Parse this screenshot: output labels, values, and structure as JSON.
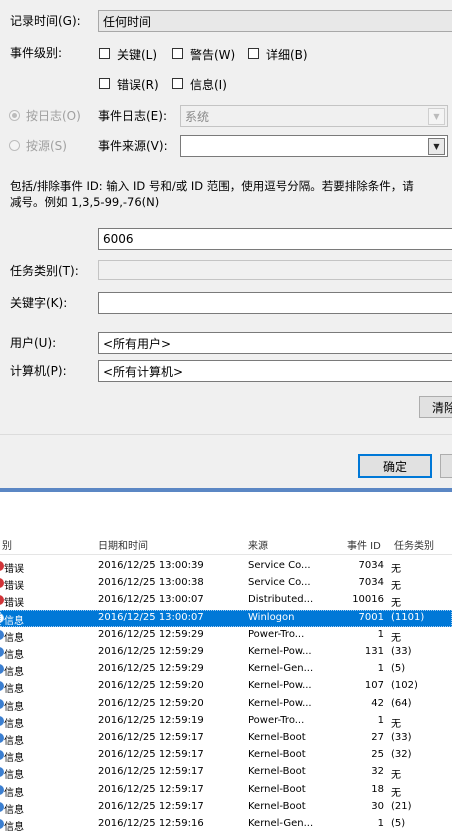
{
  "filter": {
    "logged_label": "记录时间(G):",
    "logged_value": "任何时间",
    "level_label": "事件级别:",
    "levels": [
      {
        "label": "关键(L)",
        "checked": false
      },
      {
        "label": "警告(W)",
        "checked": false
      },
      {
        "label": "详细(B)",
        "checked": false
      },
      {
        "label": "错误(R)",
        "checked": false
      },
      {
        "label": "信息(I)",
        "checked": false
      }
    ],
    "by_log_label": "按日志(O)",
    "by_source_label": "按源(S)",
    "event_logs_label": "事件日志(E):",
    "event_logs_value": "系统",
    "event_sources_label": "事件来源(V):",
    "event_sources_value": "",
    "description": "包括/排除事件 ID: 输入 ID 号和/或 ID 范围，使用逗号分隔。若要排除条件，请",
    "description_line2": "减号。例如 1,3,5-99,-76(N)",
    "event_id_value": "6006",
    "task_category_label": "任务类别(T):",
    "keywords_label": "关键字(K):",
    "user_label": "用户(U):",
    "user_value": "<所有用户>",
    "computer_label": "计算机(P):",
    "computer_value": "<所有计算机>",
    "clear_label": "清除",
    "ok_label": "确定"
  },
  "events": {
    "columns": [
      "别",
      "日期和时间",
      "来源",
      "事件 ID",
      "任务类别"
    ],
    "rows": [
      {
        "level": "错误",
        "type": "err",
        "date": "2016/12/25 13:00:39",
        "source": "Service Co...",
        "id": "7034",
        "task": "无",
        "selected": false
      },
      {
        "level": "错误",
        "type": "err",
        "date": "2016/12/25 13:00:38",
        "source": "Service Co...",
        "id": "7034",
        "task": "无",
        "selected": false
      },
      {
        "level": "错误",
        "type": "err",
        "date": "2016/12/25 13:00:07",
        "source": "Distributed...",
        "id": "10016",
        "task": "无",
        "selected": false
      },
      {
        "level": "信息",
        "type": "info",
        "date": "2016/12/25 13:00:07",
        "source": "Winlogon",
        "id": "7001",
        "task": "(1101)",
        "selected": true
      },
      {
        "level": "信息",
        "type": "info",
        "date": "2016/12/25 12:59:29",
        "source": "Power-Tro...",
        "id": "1",
        "task": "无",
        "selected": false
      },
      {
        "level": "信息",
        "type": "info",
        "date": "2016/12/25 12:59:29",
        "source": "Kernel-Pow...",
        "id": "131",
        "task": "(33)",
        "selected": false
      },
      {
        "level": "信息",
        "type": "info",
        "date": "2016/12/25 12:59:29",
        "source": "Kernel-Gen...",
        "id": "1",
        "task": "(5)",
        "selected": false
      },
      {
        "level": "信息",
        "type": "info",
        "date": "2016/12/25 12:59:20",
        "source": "Kernel-Pow...",
        "id": "107",
        "task": "(102)",
        "selected": false
      },
      {
        "level": "信息",
        "type": "info",
        "date": "2016/12/25 12:59:20",
        "source": "Kernel-Pow...",
        "id": "42",
        "task": "(64)",
        "selected": false
      },
      {
        "level": "信息",
        "type": "info",
        "date": "2016/12/25 12:59:19",
        "source": "Power-Tro...",
        "id": "1",
        "task": "无",
        "selected": false
      },
      {
        "level": "信息",
        "type": "info",
        "date": "2016/12/25 12:59:17",
        "source": "Kernel-Boot",
        "id": "27",
        "task": "(33)",
        "selected": false
      },
      {
        "level": "信息",
        "type": "info",
        "date": "2016/12/25 12:59:17",
        "source": "Kernel-Boot",
        "id": "25",
        "task": "(32)",
        "selected": false
      },
      {
        "level": "信息",
        "type": "info",
        "date": "2016/12/25 12:59:17",
        "source": "Kernel-Boot",
        "id": "32",
        "task": "无",
        "selected": false
      },
      {
        "level": "信息",
        "type": "info",
        "date": "2016/12/25 12:59:17",
        "source": "Kernel-Boot",
        "id": "18",
        "task": "无",
        "selected": false
      },
      {
        "level": "信息",
        "type": "info",
        "date": "2016/12/25 12:59:17",
        "source": "Kernel-Boot",
        "id": "30",
        "task": "(21)",
        "selected": false
      },
      {
        "level": "信息",
        "type": "info",
        "date": "2016/12/25 12:59:16",
        "source": "Kernel-Gen...",
        "id": "1",
        "task": "(5)",
        "selected": false
      }
    ]
  }
}
